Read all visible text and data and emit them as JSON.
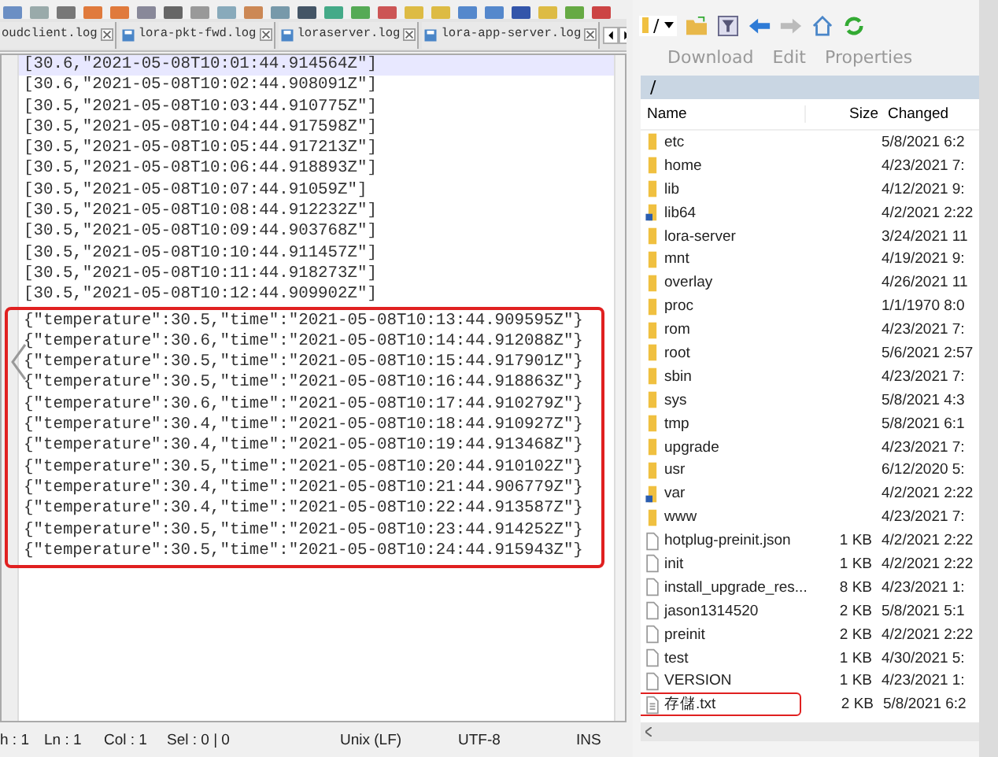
{
  "editor_tabs": [
    {
      "label": "oudclient.log"
    },
    {
      "label": "lora-pkt-fwd.log"
    },
    {
      "label": "loraserver.log"
    },
    {
      "label": "lora-app-server.log"
    }
  ],
  "editor": {
    "blocks": [
      {
        "marked": false,
        "lines": [
          {
            "text": "[30.6,\"2021-05-08T10:01:44.914564Z\"]",
            "current": true
          },
          {
            "text": "[30.6,\"2021-05-08T10:02:44.908091Z\"]",
            "current": false
          },
          {
            "text": "[30.5,\"2021-05-08T10:03:44.910775Z\"]",
            "current": false
          },
          {
            "text": "[30.5,\"2021-05-08T10:04:44.917598Z\"]",
            "current": false
          },
          {
            "text": "[30.5,\"2021-05-08T10:05:44.917213Z\"]",
            "current": false
          },
          {
            "text": "[30.5,\"2021-05-08T10:06:44.918893Z\"]",
            "current": false
          },
          {
            "text": "[30.5,\"2021-05-08T10:07:44.91059Z\"]",
            "current": false
          },
          {
            "text": "[30.5,\"2021-05-08T10:08:44.912232Z\"]",
            "current": false
          },
          {
            "text": "[30.5,\"2021-05-08T10:09:44.903768Z\"]",
            "current": false
          },
          {
            "text": "[30.5,\"2021-05-08T10:10:44.911457Z\"]",
            "current": false
          },
          {
            "text": "[30.5,\"2021-05-08T10:11:44.918273Z\"]",
            "current": false
          },
          {
            "text": "[30.5,\"2021-05-08T10:12:44.909902Z\"]",
            "current": false
          }
        ]
      },
      {
        "marked": true,
        "lines": [
          {
            "text": "{\"temperature\":30.5,\"time\":\"2021-05-08T10:13:44.909595Z\"}",
            "current": false
          },
          {
            "text": "{\"temperature\":30.6,\"time\":\"2021-05-08T10:14:44.912088Z\"}",
            "current": false
          },
          {
            "text": "{\"temperature\":30.5,\"time\":\"2021-05-08T10:15:44.917901Z\"}",
            "current": false
          },
          {
            "text": "{\"temperature\":30.5,\"time\":\"2021-05-08T10:16:44.918863Z\"}",
            "current": false
          },
          {
            "text": "{\"temperature\":30.6,\"time\":\"2021-05-08T10:17:44.910279Z\"}",
            "current": false
          },
          {
            "text": "{\"temperature\":30.4,\"time\":\"2021-05-08T10:18:44.910927Z\"}",
            "current": false
          },
          {
            "text": "{\"temperature\":30.4,\"time\":\"2021-05-08T10:19:44.913468Z\"}",
            "current": false
          },
          {
            "text": "{\"temperature\":30.5,\"time\":\"2021-05-08T10:20:44.910102Z\"}",
            "current": false
          },
          {
            "text": "{\"temperature\":30.4,\"time\":\"2021-05-08T10:21:44.906779Z\"}",
            "current": false
          },
          {
            "text": "{\"temperature\":30.4,\"time\":\"2021-05-08T10:22:44.913587Z\"}",
            "current": false
          },
          {
            "text": "{\"temperature\":30.5,\"time\":\"2021-05-08T10:23:44.914252Z\"}",
            "current": false
          },
          {
            "text": "{\"temperature\":30.5,\"time\":\"2021-05-08T10:24:44.915943Z\"}",
            "current": false
          }
        ]
      }
    ]
  },
  "status_bar": [
    "h : 1",
    "Ln : 1",
    "Col : 1",
    "Sel : 0 | 0",
    "Unix (LF)",
    "UTF-8",
    "INS"
  ],
  "file_browser": {
    "path_dropdown": "/",
    "toolbar": [
      "Download",
      "Edit",
      "Properties"
    ],
    "path": "/",
    "columns": [
      "Name",
      "Size",
      "Changed"
    ],
    "files": [
      {
        "kind": "folder",
        "name": "etc",
        "changed": "5/8/2021 6:2",
        "marked": false
      },
      {
        "kind": "folder",
        "name": "home",
        "changed": "4/23/2021 7:",
        "marked": false
      },
      {
        "kind": "folder",
        "name": "lib",
        "changed": "4/12/2021 9:",
        "marked": false
      },
      {
        "kind": "link",
        "name": "lib64",
        "changed": "4/2/2021 2:22",
        "marked": false
      },
      {
        "kind": "folder",
        "name": "lora-server",
        "changed": "3/24/2021 11",
        "marked": false
      },
      {
        "kind": "folder",
        "name": "mnt",
        "changed": "4/19/2021 9:",
        "marked": false
      },
      {
        "kind": "folder",
        "name": "overlay",
        "changed": "4/26/2021 11",
        "marked": false
      },
      {
        "kind": "folder",
        "name": "proc",
        "changed": "1/1/1970 8:0",
        "marked": false
      },
      {
        "kind": "folder",
        "name": "rom",
        "changed": "4/23/2021 7:",
        "marked": false
      },
      {
        "kind": "folder",
        "name": "root",
        "changed": "5/6/2021 2:57",
        "marked": false
      },
      {
        "kind": "folder",
        "name": "sbin",
        "changed": "4/23/2021 7:",
        "marked": false
      },
      {
        "kind": "folder",
        "name": "sys",
        "changed": "5/8/2021 4:3",
        "marked": false
      },
      {
        "kind": "folder",
        "name": "tmp",
        "changed": "5/8/2021 6:1",
        "marked": false
      },
      {
        "kind": "folder",
        "name": "upgrade",
        "changed": "4/23/2021 7:",
        "marked": false
      },
      {
        "kind": "folder",
        "name": "usr",
        "changed": "6/12/2020 5:",
        "marked": false
      },
      {
        "kind": "link",
        "name": "var",
        "changed": "4/2/2021 2:22",
        "marked": false
      },
      {
        "kind": "folder",
        "name": "www",
        "changed": "4/23/2021 7:",
        "marked": false
      },
      {
        "kind": "file",
        "name": "hotplug-preinit.json",
        "size": "1 KB",
        "changed": "4/2/2021 2:22",
        "marked": false
      },
      {
        "kind": "file",
        "name": "init",
        "size": "1 KB",
        "changed": "4/2/2021 2:22",
        "marked": false
      },
      {
        "kind": "file",
        "name": "install_upgrade_res...",
        "size": "8 KB",
        "changed": "4/23/2021 1:",
        "marked": false
      },
      {
        "kind": "file",
        "name": "jason1314520",
        "size": "2 KB",
        "changed": "5/8/2021 5:1",
        "marked": false
      },
      {
        "kind": "file",
        "name": "preinit",
        "size": "2 KB",
        "changed": "4/2/2021 2:22",
        "marked": false
      },
      {
        "kind": "file",
        "name": "test",
        "size": "1 KB",
        "changed": "4/30/2021 5:",
        "marked": false
      },
      {
        "kind": "file",
        "name": "VERSION",
        "size": "1 KB",
        "changed": "4/23/2021 1:",
        "marked": false
      },
      {
        "kind": "text",
        "name": "存儲.txt",
        "size": "2 KB",
        "changed": "5/8/2021 6:2",
        "marked": true
      }
    ]
  }
}
